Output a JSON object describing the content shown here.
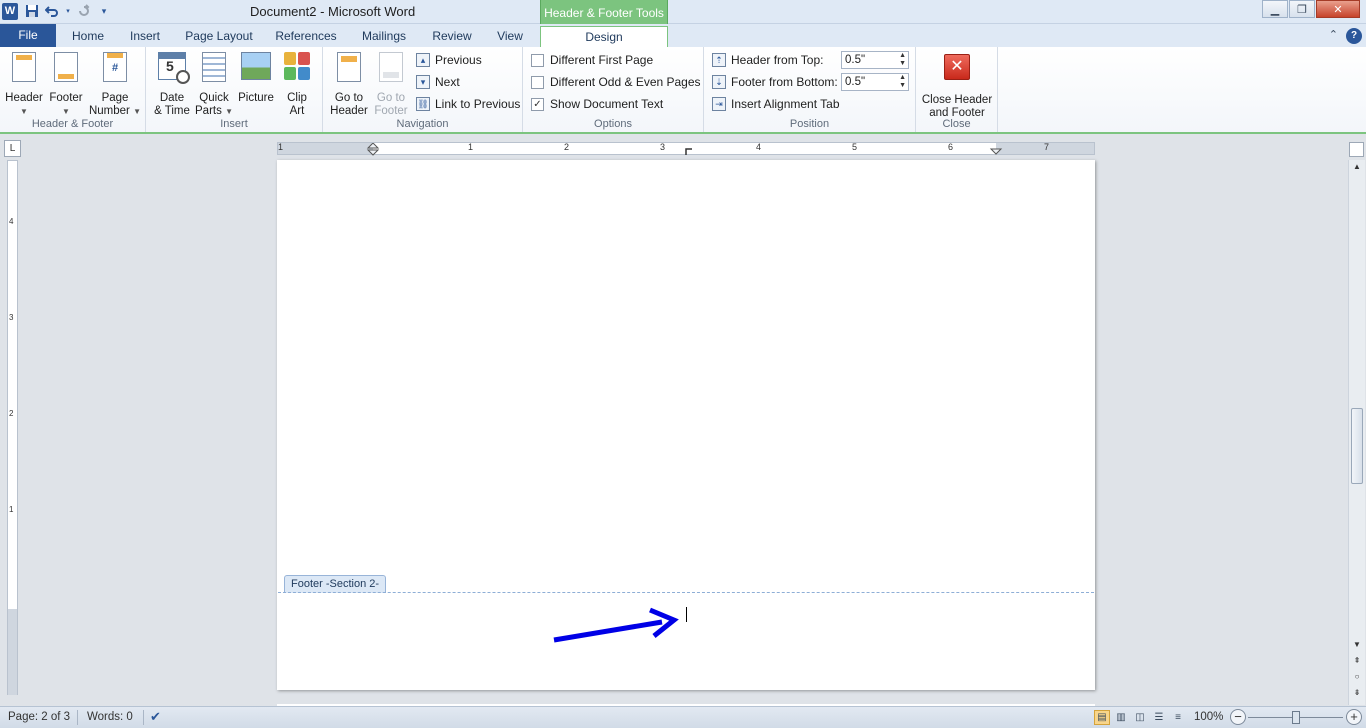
{
  "window": {
    "title": "Document2  -  Microsoft Word",
    "contextual_tab_group": "Header & Footer Tools",
    "controls": [
      "minimize-icon",
      "restore-icon",
      "close-icon"
    ]
  },
  "quick_access": {
    "app_icon_letter": "W",
    "buttons": [
      "save-icon",
      "undo-icon",
      "redo-icon",
      "customize-icon"
    ]
  },
  "tabs": [
    {
      "label": "File"
    },
    {
      "label": "Home"
    },
    {
      "label": "Insert"
    },
    {
      "label": "Page Layout"
    },
    {
      "label": "References"
    },
    {
      "label": "Mailings"
    },
    {
      "label": "Review"
    },
    {
      "label": "View"
    },
    {
      "label": "Design"
    }
  ],
  "ribbon": {
    "header_footer": {
      "label": "Header & Footer",
      "header": "Header",
      "footer": "Footer",
      "page_number_l1": "Page",
      "page_number_l2": "Number",
      "page_number_icon_text": "#"
    },
    "insert": {
      "label": "Insert",
      "date_l1": "Date",
      "date_l2": "& Time",
      "date_icon_num": "5",
      "quick_l1": "Quick",
      "quick_l2": "Parts",
      "picture": "Picture",
      "clip_l1": "Clip",
      "clip_l2": "Art"
    },
    "navigation": {
      "label": "Navigation",
      "go_header_l1": "Go to",
      "go_header_l2": "Header",
      "go_footer_l1": "Go to",
      "go_footer_l2": "Footer",
      "previous": "Previous",
      "next": "Next",
      "link_previous": "Link to Previous"
    },
    "options": {
      "label": "Options",
      "different_first": "Different First Page",
      "different_odd_even": "Different Odd & Even Pages",
      "show_document_text": "Show Document Text",
      "show_document_text_checked": true
    },
    "position": {
      "label": "Position",
      "header_from_top_label": "Header from Top:",
      "header_from_top_value": "0.5\"",
      "footer_from_bottom_label": "Footer from Bottom:",
      "footer_from_bottom_value": "0.5\"",
      "insert_alignment_tab": "Insert Alignment Tab"
    },
    "close": {
      "label": "Close",
      "close_l1": "Close Header",
      "close_l2": "and Footer"
    }
  },
  "ruler": {
    "numbers": [
      "1",
      "1",
      "2",
      "3",
      "4",
      "5",
      "6",
      "7"
    ],
    "vertical_numbers": [
      "4",
      "3",
      "2",
      "1"
    ]
  },
  "document": {
    "footer_tag": "Footer -Section 2-",
    "annotation_arrow_color": "#0000e6"
  },
  "statusbar": {
    "page": "Page: 2 of 3",
    "words": "Words: 0",
    "zoom": "100%",
    "zoom_level_percent": 100
  },
  "colors": {
    "file_tab": "#2a5699",
    "contextual_green": "#7cc47f",
    "close_red": "#c9291b"
  }
}
